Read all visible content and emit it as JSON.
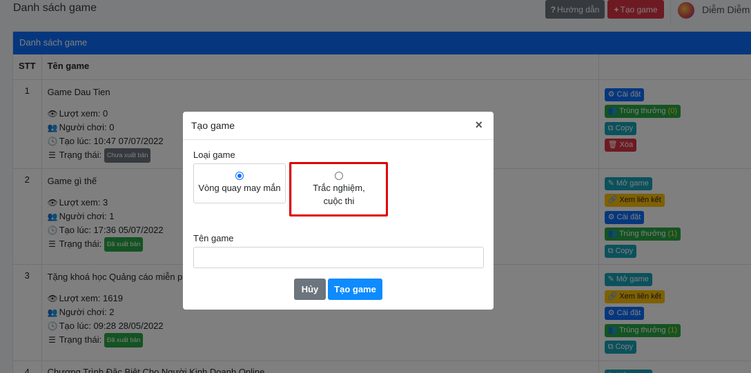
{
  "header": {
    "title": "Danh sách game",
    "guide_label": "Hướng dẫn",
    "create_label": "Tạo game",
    "user_name": "Diễm Diễm"
  },
  "icons": {
    "question": "?",
    "plus": "+",
    "eye": "👁",
    "users": "👥",
    "clock": "🕓",
    "list": "☰",
    "gear": "⚙",
    "trophy": "👥",
    "copy": "⧉",
    "trash": "🗑",
    "edit": "✎",
    "link": "🔗",
    "close": "×"
  },
  "card": {
    "header": "Danh sách game",
    "columns": {
      "stt": "STT",
      "name": "Tên game"
    }
  },
  "labels": {
    "views": "Lượt xem:",
    "players": "Người chơi:",
    "created": "Tạo lúc:",
    "status": "Trạng thái:"
  },
  "rows": [
    {
      "stt": "1",
      "name": "Game Dau Tien",
      "views": "0",
      "players": "0",
      "created": "10:47 07/07/2022",
      "status": "Chưa xuất bản"
    },
    {
      "stt": "2",
      "name": "Game gì thế",
      "views": "3",
      "players": "1",
      "created": "17:36 05/07/2022",
      "status": "Đã xuất bản"
    },
    {
      "stt": "3",
      "name": "Tặng khoá học Quảng cáo miễn phí",
      "views": "1619",
      "players": "2",
      "created": "09:28 28/05/2022",
      "status": "Đã xuất bản"
    },
    {
      "stt": "4",
      "name": "Chương Trình Đặc Biệt Cho Người Kinh Doanh Online"
    }
  ],
  "actions": {
    "settings": "Cài đặt",
    "winners": "Trúng thưởng",
    "copy": "Copy",
    "delete": "Xóa",
    "open": "Mở game",
    "view_link": "Xem liên kết",
    "winners_count_1": "(0)",
    "winners_count_2": "(1)",
    "winners_count_3": "(1)"
  },
  "modal": {
    "title": "Tạo game",
    "type_label": "Loại game",
    "option_wheel": "Vòng quay may mắn",
    "option_quiz": "Trắc nghiệm, cuộc thi",
    "selected": "Vòng quay may mắn",
    "name_label": "Tên game",
    "name_value": "",
    "cancel_label": "Hủy",
    "submit_label": "Tạo game"
  },
  "colors": {
    "primary": "#0d6efd",
    "danger": "#dc3545",
    "success": "#28a745",
    "secondary": "#6c757d",
    "warning": "#ffc107",
    "info": "#17a2b8",
    "highlight": "#e00000"
  }
}
